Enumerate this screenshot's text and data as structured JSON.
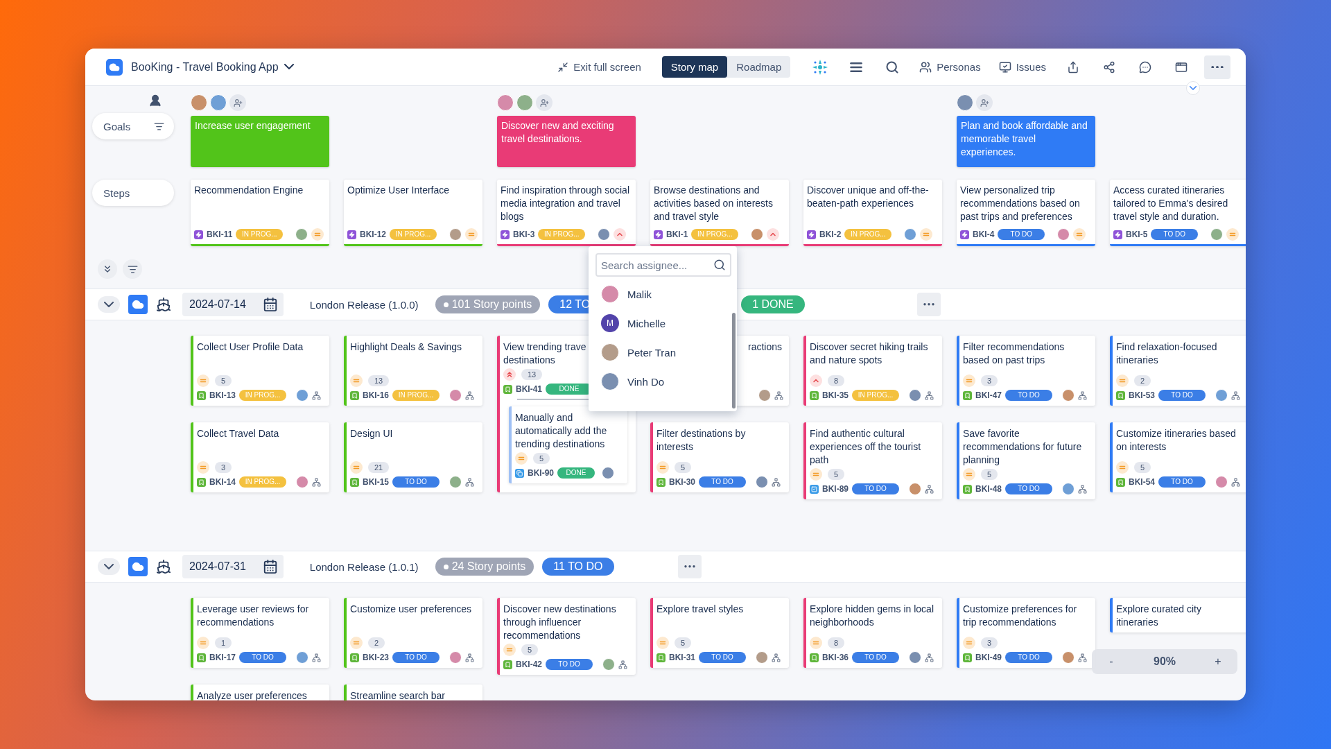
{
  "header": {
    "title": "BooKing - Travel Booking App",
    "exit_label": "Exit full screen",
    "tabs": [
      {
        "label": "Story map",
        "selected": true
      },
      {
        "label": "Roadmap",
        "selected": false
      }
    ],
    "links": [
      {
        "kind": "personas",
        "label": "Personas"
      },
      {
        "kind": "issues",
        "label": "Issues"
      }
    ]
  },
  "lanes": {
    "goals_label": "Goals",
    "steps_label": "Steps"
  },
  "columns": [
    {
      "members": [
        {
          "kind": "avatar"
        },
        {
          "kind": "avatar"
        },
        {
          "kind": "add"
        }
      ],
      "goal": {
        "text": "Increase user engagement",
        "color": "#52c41a"
      },
      "step": {
        "title": "Recommendation Engine",
        "kind": "epic",
        "id": "BKI-11",
        "status": {
          "kind": "progress",
          "text": "IN PROG..."
        },
        "priority": {
          "kind": "medium"
        },
        "color": "#52c41a"
      }
    },
    {
      "step": {
        "title": "Optimize User Interface",
        "kind": "epic",
        "id": "BKI-12",
        "status": {
          "kind": "progress",
          "text": "IN PROG..."
        },
        "priority": {
          "kind": "medium"
        },
        "color": "#52c41a"
      }
    },
    {
      "members": [
        {
          "kind": "avatar"
        },
        {
          "kind": "avatar"
        },
        {
          "kind": "add"
        }
      ],
      "goal": {
        "text": "Discover new and exciting travel destinations.",
        "color": "#e93b76"
      },
      "step": {
        "title": "Find inspiration through social media integration and travel blogs",
        "kind": "epic",
        "id": "BKI-3",
        "status": {
          "kind": "progress",
          "text": "IN PROG..."
        },
        "priority": {
          "kind": "high"
        },
        "color": "#e93b76"
      }
    },
    {
      "step": {
        "title": "Browse destinations and activities based on interests and travel style",
        "kind": "epic",
        "id": "BKI-1",
        "status": {
          "kind": "progress",
          "text": "IN PROG..."
        },
        "priority": {
          "kind": "high"
        },
        "color": "#e93b76"
      }
    },
    {
      "step": {
        "title": "Discover unique and off-the-beaten-path experiences",
        "kind": "epic",
        "id": "BKI-2",
        "status": {
          "kind": "progress",
          "text": "IN PROG..."
        },
        "priority": {
          "kind": "medium"
        },
        "color": "#e93b76"
      }
    },
    {
      "members": [
        {
          "kind": "avatar"
        },
        {
          "kind": "add"
        }
      ],
      "goal": {
        "text": "Plan and book affordable and memorable travel experiences.",
        "color": "#2f7bf5"
      },
      "step": {
        "title": "View personalized trip recommendations based on past trips and preferences",
        "kind": "epic",
        "id": "BKI-4",
        "status": {
          "kind": "todo",
          "text": "TO DO"
        },
        "priority": {
          "kind": "medium"
        },
        "color": "#2f7bf5"
      }
    },
    {
      "step": {
        "title": "Access curated itineraries tailored to Emma's desired travel style and duration.",
        "kind": "epic",
        "id": "BKI-5",
        "status": {
          "kind": "todo",
          "text": "TO DO"
        },
        "priority": {
          "kind": "medium"
        },
        "color": "#2f7bf5"
      }
    }
  ],
  "releases": [
    {
      "date": "2024-07-14",
      "name": "London Release (1.0.0)",
      "points": "101 Story points",
      "expanded": true,
      "statuses": [
        {
          "kind": "todo",
          "text": "12 TO"
        },
        {
          "kind": "done",
          "text": "1 DONE"
        }
      ],
      "assignee_menu": {
        "placeholder": "Search assignee...",
        "options": [
          {
            "kind": "photo",
            "name": "Malik"
          },
          {
            "kind": "initial",
            "initial": "M",
            "name": "Michelle"
          },
          {
            "kind": "photo",
            "name": "Peter Tran"
          },
          {
            "kind": "photo",
            "name": "Vinh Do"
          }
        ]
      },
      "columns": [
        {
          "color": "#52c41a",
          "cards": [
            {
              "title": "Collect User Profile Data",
              "priority": {
                "kind": "medium"
              },
              "points": "5",
              "kind": "story",
              "id": "BKI-13",
              "status": {
                "kind": "progress",
                "text": "IN PROG..."
              },
              "hierarchy": true
            },
            {
              "title": "Collect Travel Data",
              "priority": {
                "kind": "medium"
              },
              "points": "3",
              "kind": "story",
              "id": "BKI-14",
              "status": {
                "kind": "progress",
                "text": "IN PROG..."
              },
              "hierarchy": true
            }
          ]
        },
        {
          "color": "#52c41a",
          "cards": [
            {
              "title": "Highlight Deals & Savings",
              "priority": {
                "kind": "medium"
              },
              "points": "13",
              "kind": "story",
              "id": "BKI-16",
              "status": {
                "kind": "progress",
                "text": "IN PROG..."
              },
              "hierarchy": true
            },
            {
              "title": "Design UI",
              "priority": {
                "kind": "medium"
              },
              "points": "21",
              "kind": "story",
              "id": "BKI-15",
              "status": {
                "kind": "todo",
                "text": "TO DO"
              },
              "hierarchy": true
            }
          ]
        },
        {
          "color": "#e93b76",
          "cards": [
            {
              "title": "View trending trave\ndestinations",
              "priority": {
                "kind": "highest"
              },
              "points": "13",
              "kind": "story",
              "id": "BKI-41",
              "status": {
                "kind": "done",
                "text": "DONE"
              },
              "children": [
                {
                  "title": "Manually and automatically add the trending destinations",
                  "priority": {
                    "kind": "medium"
                  },
                  "points": "5",
                  "kind": "subtask",
                  "id": "BKI-90",
                  "status": {
                    "kind": "done",
                    "text": "DONE"
                  },
                  "hierarchy": false
                }
              ]
            }
          ]
        },
        {
          "color": "#e93b76",
          "cards": [
            {
              "title": "ractions",
              "covered": true,
              "hierarchy": true
            },
            {
              "title": "Filter destinations by interests",
              "priority": {
                "kind": "medium"
              },
              "points": "5",
              "kind": "story",
              "id": "BKI-30",
              "status": {
                "kind": "todo",
                "text": "TO DO"
              },
              "hierarchy": true
            }
          ]
        },
        {
          "color": "#e93b76",
          "cards": [
            {
              "title": "Discover secret hiking trails and nature spots",
              "priority": {
                "kind": "high"
              },
              "points": "8",
              "kind": "story",
              "id": "BKI-35",
              "status": {
                "kind": "progress",
                "text": "IN PROG..."
              },
              "hierarchy": true
            },
            {
              "title": "Find authentic cultural experiences off the tourist path",
              "priority": {
                "kind": "medium"
              },
              "points": "5",
              "kind": "task",
              "id": "BKI-89",
              "status": {
                "kind": "todo",
                "text": "TO DO"
              },
              "hierarchy": true
            }
          ]
        },
        {
          "color": "#2f7bf5",
          "cards": [
            {
              "title": "Filter recommendations based on past trips",
              "priority": {
                "kind": "medium"
              },
              "points": "3",
              "kind": "story",
              "id": "BKI-47",
              "status": {
                "kind": "todo",
                "text": "TO DO"
              },
              "hierarchy": true
            },
            {
              "title": "Save favorite recommendations for future planning",
              "priority": {
                "kind": "medium"
              },
              "points": "5",
              "kind": "story",
              "id": "BKI-48",
              "status": {
                "kind": "todo",
                "text": "TO DO"
              },
              "hierarchy": true
            }
          ]
        },
        {
          "color": "#2f7bf5",
          "cards": [
            {
              "title": "Find relaxation-focused itineraries",
              "priority": {
                "kind": "medium"
              },
              "points": "2",
              "kind": "story",
              "id": "BKI-53",
              "status": {
                "kind": "todo",
                "text": "TO DO"
              },
              "hierarchy": true
            },
            {
              "title": "Customize itineraries based on interests",
              "priority": {
                "kind": "medium"
              },
              "points": "5",
              "kind": "story",
              "id": "BKI-54",
              "status": {
                "kind": "todo",
                "text": "TO DO"
              },
              "hierarchy": true
            }
          ]
        }
      ]
    },
    {
      "date": "2024-07-31",
      "name": "London Release (1.0.1)",
      "points": "24 Story points",
      "expanded": true,
      "statuses": [
        {
          "kind": "todo",
          "text": "11 TO DO"
        }
      ],
      "columns": [
        {
          "color": "#52c41a",
          "cards": [
            {
              "title": "Leverage user reviews for recommendations",
              "priority": {
                "kind": "medium"
              },
              "points": "1",
              "kind": "story",
              "id": "BKI-17",
              "status": {
                "kind": "todo",
                "text": "TO DO"
              },
              "hierarchy": true
            },
            {
              "title": "Analyze user preferences"
            }
          ]
        },
        {
          "color": "#52c41a",
          "cards": [
            {
              "title": "Customize user preferences",
              "priority": {
                "kind": "medium"
              },
              "points": "2",
              "kind": "story",
              "id": "BKI-23",
              "status": {
                "kind": "todo",
                "text": "TO DO"
              },
              "hierarchy": true
            },
            {
              "title": "Streamline search bar"
            }
          ]
        },
        {
          "color": "#e93b76",
          "cards": [
            {
              "title": "Discover new destinations through influencer recommendations",
              "priority": {
                "kind": "medium"
              },
              "points": "5",
              "kind": "story",
              "id": "BKI-42",
              "status": {
                "kind": "todo",
                "text": "TO DO"
              },
              "hierarchy": true
            }
          ]
        },
        {
          "color": "#e93b76",
          "cards": [
            {
              "title": "Explore travel styles",
              "priority": {
                "kind": "medium"
              },
              "points": "5",
              "kind": "story",
              "id": "BKI-31",
              "status": {
                "kind": "todo",
                "text": "TO DO"
              },
              "hierarchy": true
            }
          ]
        },
        {
          "color": "#e93b76",
          "cards": [
            {
              "title": "Explore hidden gems in local neighborhoods",
              "priority": {
                "kind": "medium"
              },
              "points": "8",
              "kind": "story",
              "id": "BKI-36",
              "status": {
                "kind": "todo",
                "text": "TO DO"
              },
              "hierarchy": true
            }
          ]
        },
        {
          "color": "#2f7bf5",
          "cards": [
            {
              "title": "Customize preferences for trip recommendations",
              "priority": {
                "kind": "medium"
              },
              "points": "3",
              "kind": "story",
              "id": "BKI-49",
              "status": {
                "kind": "todo",
                "text": "TO DO"
              },
              "hierarchy": true
            }
          ]
        },
        {
          "color": "#2f7bf5",
          "cards": [
            {
              "title": "Explore curated city itineraries"
            }
          ]
        }
      ]
    }
  ],
  "zoom": {
    "minus": "-",
    "level": "90%",
    "plus": "+"
  }
}
